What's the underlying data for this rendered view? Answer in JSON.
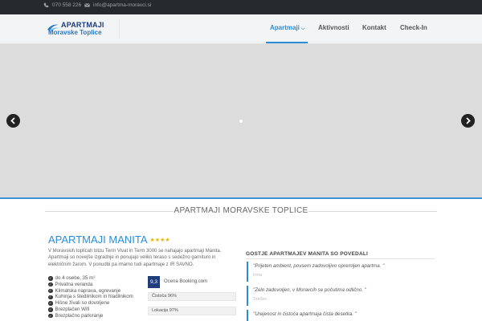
{
  "topbar": {
    "phone": "070 558 226",
    "email": "info@apartma-moravci.si"
  },
  "logo": {
    "line1": "APARTMAJI",
    "line2": "Moravske Toplice"
  },
  "nav": {
    "items": [
      {
        "label": "Apartmaji",
        "active": true,
        "has_dropdown": true
      },
      {
        "label": "Aktivnosti"
      },
      {
        "label": "Kontakt"
      },
      {
        "label": "Check-In"
      }
    ]
  },
  "slider": {
    "prev_icon": "chevron-left-icon",
    "next_icon": "chevron-right-icon"
  },
  "section": {
    "title": "APARTMAJI MORAVSKE TOPLICE"
  },
  "manita": {
    "title": "APARTMAJI MANITA",
    "stars": "★★★★",
    "description": "V Moravskih toplicah blizu Term Vivat in Term 3000 se nahajajo apartmaji Manita. Apartmaji so novejše izgradnje in ponujajo veliko teraso s sedežno garnituro in električnim žarom. V ponudbi pa imamo tudi apartmaje z IR SAVNO.",
    "features": [
      "do 4 osebe, 35 m²",
      "Privatna veranda",
      "Klimatska naprava, ogrevanje",
      "Kuhinja s štedilnikom in hladilnikom",
      "Hišne živali so dovoljene",
      "Brezplačen Wifi",
      "Brezplačno parkiranje"
    ],
    "rating": {
      "score": "9,3",
      "label": "Ocena Booking.com",
      "bars": [
        {
          "label": "Čistoča 96%"
        },
        {
          "label": "Lokacija 97%"
        }
      ]
    }
  },
  "guests": {
    "heading": "GOSTJE APARTMAJEV MANITA SO POVEDALI",
    "quotes": [
      {
        "text": "\"Prijeten ambient, povsem zadovoljivo opremljen apartma. \"",
        "author": "Irma"
      },
      {
        "text": "\"Zelo zadovoljen, v Moravcih se počutima odlično. \"",
        "author": "Srečko"
      },
      {
        "text": "\"Urejenost in čistoča apartmaja čista desetka. \"",
        "author": ""
      }
    ]
  },
  "colors": {
    "accent": "#2b8cd6",
    "topbar": "#262a2e",
    "booking": "#1f3e7a",
    "stars": "#f0b400"
  }
}
